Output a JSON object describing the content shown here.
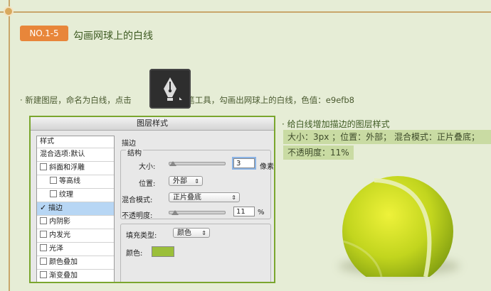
{
  "step": {
    "badge": "NO.1-5",
    "title": "勾画网球上的白线"
  },
  "instruction": {
    "before": "· 新建图层，命名为白线，点击",
    "after": "钢笔工具，勾画出网球上的白线，色值：e9efb8",
    "tool_icon": "pen-tool-icon"
  },
  "right_panel": {
    "title": "· 给白线增加描边的图层样式",
    "line1": "大小：3px ；位置：外部；  混合模式：正片叠底；",
    "line2": "不透明度：11%"
  },
  "dialog": {
    "title": "图层样式",
    "styles": {
      "header": "样式",
      "blend_options": "混合选项:默认",
      "items": [
        {
          "label": "斜面和浮雕",
          "checked": false,
          "indent": false
        },
        {
          "label": "等高线",
          "checked": false,
          "indent": true
        },
        {
          "label": "纹理",
          "checked": false,
          "indent": true
        },
        {
          "label": "描边",
          "checked": true,
          "indent": false,
          "selected": true
        },
        {
          "label": "内阴影",
          "checked": false,
          "indent": false
        },
        {
          "label": "内发光",
          "checked": false,
          "indent": false
        },
        {
          "label": "光泽",
          "checked": false,
          "indent": false
        },
        {
          "label": "颜色叠加",
          "checked": false,
          "indent": false
        },
        {
          "label": "渐变叠加",
          "checked": false,
          "indent": false
        }
      ]
    },
    "stroke": {
      "section_title": "描边",
      "structure_title": "结构",
      "size_label": "大小:",
      "size_value": "3",
      "size_unit": "像素",
      "position_label": "位置:",
      "position_value": "外部",
      "blend_label": "混合模式:",
      "blend_value": "正片叠底",
      "opacity_label": "不透明度:",
      "opacity_value": "11",
      "opacity_unit": "%",
      "fill_type_label": "填充类型:",
      "fill_type_value": "颜色",
      "color_label": "颜色:",
      "color_value": "#9bbf3a",
      "size_fraction": 0.02,
      "opacity_fraction": 0.11
    }
  },
  "colors": {
    "badge": "#e8863a",
    "background": "#e6edd6",
    "highlight": "#c9dba3",
    "stroke_line": "#e9efb8"
  }
}
